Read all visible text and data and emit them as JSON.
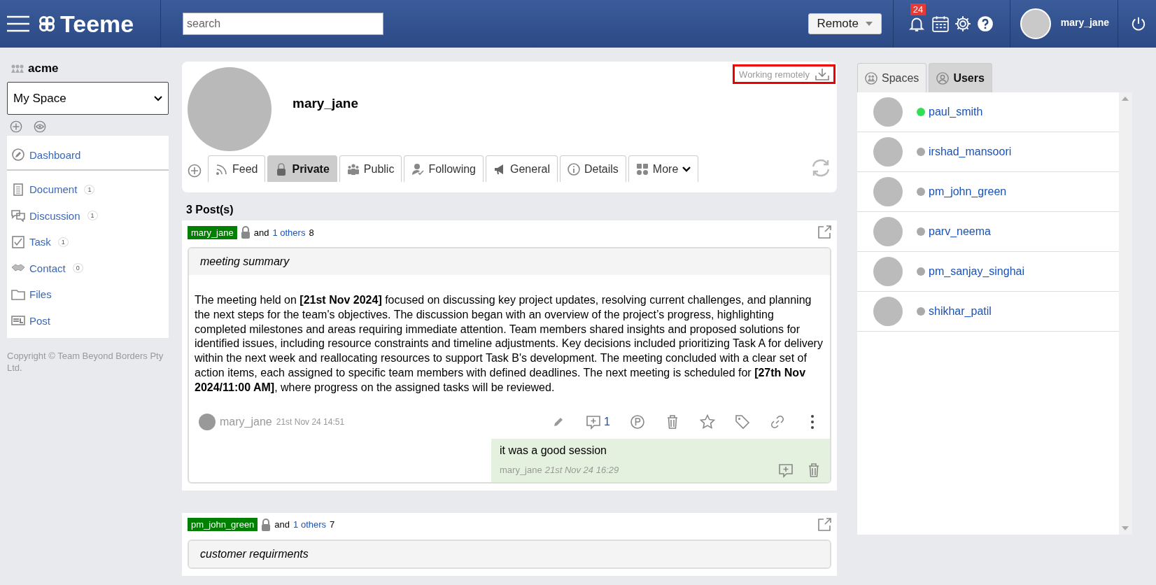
{
  "header": {
    "logo": "Teeme",
    "search": {
      "placeholder": "search"
    },
    "mode": "Remote",
    "notifications": "24",
    "user": "mary_jane"
  },
  "sidebar": {
    "org": "acme",
    "space": "My Space",
    "items": [
      {
        "label": "Dashboard"
      },
      {
        "label": "Document",
        "count": "1"
      },
      {
        "label": "Discussion",
        "count": "1"
      },
      {
        "label": "Task",
        "count": "1"
      },
      {
        "label": "Contact",
        "count": "0"
      },
      {
        "label": "Files"
      },
      {
        "label": "Post"
      }
    ],
    "copyright": "Copyright © Team Beyond Borders Pty Ltd."
  },
  "profile": {
    "name": "mary_jane",
    "status": "Working remotely",
    "status_highlighted": true,
    "tabs": [
      {
        "label": "Feed",
        "selected": false
      },
      {
        "label": "Private",
        "selected": true
      },
      {
        "label": "Public",
        "selected": false
      },
      {
        "label": "Following",
        "selected": false
      },
      {
        "label": "General",
        "selected": false
      },
      {
        "label": "Details",
        "selected": false
      },
      {
        "label": "More",
        "selected": false
      }
    ]
  },
  "posts_count": "3 Post(s)",
  "posts": [
    {
      "author": "mary_jane",
      "joiner": "and",
      "others": "1 others",
      "count": "8",
      "title": "meeting summary",
      "body": "The meeting held on **[21st Nov 2024]** focused on discussing key project updates, resolving current challenges, and planning the next steps for the team's objectives. The discussion began with an overview of the project’s progress, highlighting completed milestones and areas requiring immediate attention. Team members shared insights and proposed solutions for identified issues, including resource constraints and timeline adjustments. Key decisions included prioritizing Task A for delivery within the next week and reallocating resources to support Task B's development. The meeting concluded with a clear set of action items, each assigned to specific team members with defined deadlines. The next meeting is scheduled for **[27th Nov 2024/11:00 AM]**, where progress on the assigned tasks will be reviewed.",
      "footer_author": "mary_jane",
      "footer_time": "21st Nov 24 14:51",
      "comment_count": "1",
      "replies": [
        {
          "text": "it was a good session",
          "author": "mary_jane",
          "time": "21st Nov 24 16:29"
        }
      ]
    },
    {
      "author": "pm_john_green",
      "joiner": "and",
      "others": "1 others",
      "count": "7",
      "title": "customer requirments"
    }
  ],
  "users_panel": {
    "tabs": [
      {
        "label": "Spaces",
        "selected": false
      },
      {
        "label": "Users",
        "selected": true
      }
    ],
    "users": [
      {
        "name": "paul_smith",
        "online": true
      },
      {
        "name": "irshad_mansoori",
        "online": false
      },
      {
        "name": "pm_john_green",
        "online": false
      },
      {
        "name": "parv_neema",
        "online": false
      },
      {
        "name": "pm_sanjay_singhai",
        "online": false
      },
      {
        "name": "shikhar_patil",
        "online": false
      }
    ]
  }
}
